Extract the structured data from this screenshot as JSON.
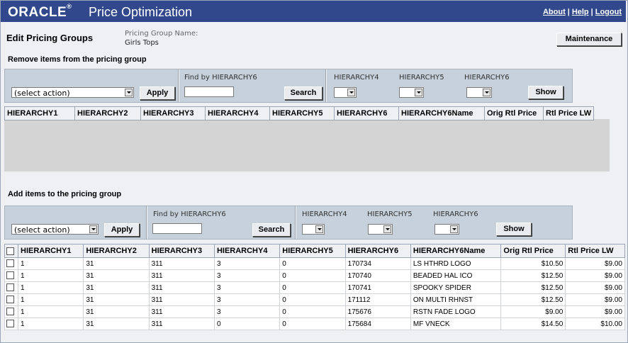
{
  "header": {
    "logo": "ORACLE",
    "app_title": "Price Optimization",
    "links": [
      "About",
      "Help",
      "Logout"
    ]
  },
  "page": {
    "title": "Edit Pricing Groups",
    "group_name_label": "Pricing Group Name:",
    "group_name_value": "Girls Tops",
    "maintenance_label": "Maintenance"
  },
  "remove_section": {
    "heading": "Remove items from the pricing group",
    "action_select": "(select action)",
    "apply_label": "Apply",
    "find_label": "Find by HIERARCHY6",
    "search_label": "Search",
    "h4_label": "HIERARCHY4",
    "h5_label": "HIERARCHY5",
    "h6_label": "HIERARCHY6",
    "show_label": "Show",
    "columns": [
      "HIERARCHY1",
      "HIERARCHY2",
      "HIERARCHY3",
      "HIERARCHY4",
      "HIERARCHY5",
      "HIERARCHY6",
      "HIERARCHY6Name",
      "Orig Rtl Price",
      "Rtl Price LW"
    ]
  },
  "add_section": {
    "heading": "Add items to the pricing group",
    "action_select": "(select action)",
    "apply_label": "Apply",
    "find_label": "Find by HIERARCHY6",
    "search_label": "Search",
    "h4_label": "HIERARCHY4",
    "h5_label": "HIERARCHY5",
    "h6_label": "HIERARCHY6",
    "show_label": "Show",
    "columns": [
      "HIERARCHY1",
      "HIERARCHY2",
      "HIERARCHY3",
      "HIERARCHY4",
      "HIERARCHY5",
      "HIERARCHY6",
      "HIERARCHY6Name",
      "Orig Rtl Price",
      "Rtl Price LW"
    ],
    "rows": [
      [
        "1",
        "31",
        "311",
        "3",
        "0",
        "170734",
        "LS HTHRD LOGO",
        "$10.50",
        "$9.00"
      ],
      [
        "1",
        "31",
        "311",
        "3",
        "0",
        "170740",
        "BEADED HAL ICO",
        "$12.50",
        "$9.00"
      ],
      [
        "1",
        "31",
        "311",
        "3",
        "0",
        "170741",
        "SPOOKY SPIDER",
        "$12.50",
        "$9.00"
      ],
      [
        "1",
        "31",
        "311",
        "3",
        "0",
        "171112",
        "ON MULTI RHNST",
        "$12.50",
        "$9.00"
      ],
      [
        "1",
        "31",
        "311",
        "3",
        "0",
        "175676",
        "RSTN FADE LOGO",
        "$9.00",
        "$9.00"
      ],
      [
        "1",
        "31",
        "311",
        "0",
        "0",
        "175684",
        "MF VNECK",
        "$14.50",
        "$10.00"
      ]
    ]
  },
  "colors": {
    "header_bg": "#31498c",
    "toolbar_bg": "#c7d1dc",
    "empty_grid_bg": "#d4d4d4"
  }
}
